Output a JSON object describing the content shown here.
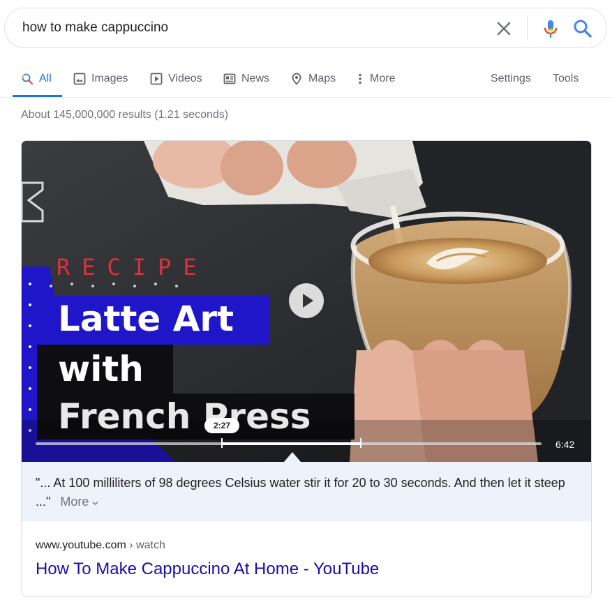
{
  "search": {
    "query": "how to make cappuccino"
  },
  "tabs": [
    {
      "label": "All",
      "icon": "search-icon",
      "active": true
    },
    {
      "label": "Images",
      "icon": "image-icon"
    },
    {
      "label": "Videos",
      "icon": "video-icon"
    },
    {
      "label": "News",
      "icon": "news-icon"
    },
    {
      "label": "Maps",
      "icon": "map-pin-icon"
    },
    {
      "label": "More",
      "icon": "more-vert-icon"
    },
    {
      "label": "Settings"
    },
    {
      "label": "Tools"
    }
  ],
  "result_stats": "About 145,000,000 results (1.21 seconds)",
  "video": {
    "overlay": {
      "recipe_label": "RECIPE",
      "title_line1": "Latte Art",
      "title_line2": "with",
      "title_line3": "French Press"
    },
    "timestamp": "2:27",
    "duration": "6:42",
    "segment_start_fraction": 0.367,
    "segment_end_fraction": 0.643
  },
  "transcript": {
    "text": "\"... At 100 milliliters of 98 degrees Celsius water stir it for 20 to 30 seconds. And then let it steep ...\"",
    "more_label": "More"
  },
  "result": {
    "domain": "www.youtube.com",
    "breadcrumb": " › watch",
    "title": "How To Make Cappuccino At Home - YouTube"
  },
  "colors": {
    "link": "#1a0dab",
    "active_tab": "#1a73e8",
    "recipe_red": "#e0303a",
    "title_panel_blue": "#1e17c4"
  }
}
